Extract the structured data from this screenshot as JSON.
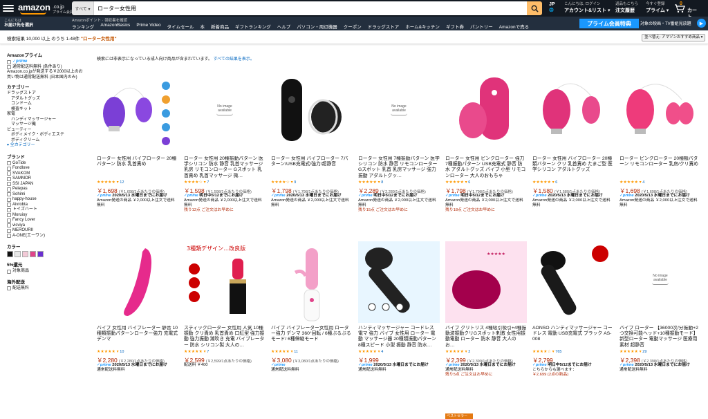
{
  "header": {
    "logo_word": "amazon",
    "logo_tld": ".co.jp",
    "logo_sub": "プライム会員",
    "search_category": "すべて ▾",
    "search_value": "ローター女性用",
    "lang": "JP",
    "lang_sub": "🌐",
    "account_small": "こんにちは, ログイン",
    "account_big": "アカウント&リスト ▾",
    "orders_small": "返品もこちら",
    "orders_big": "注文履歴",
    "prime_small": "今すぐ登録",
    "prime_big": "プライム ▾",
    "cart_count": "0",
    "cart_label": "カート"
  },
  "nav2": {
    "loc_small": "こんにちは",
    "loc_big": "お届け先を選択",
    "mini": "Amazonポイント · 領収書を確認",
    "links": [
      "ランキング",
      "AmazonBasics",
      "Prime Video",
      "タイムセール",
      "本",
      "新着商品",
      "ギフトランキング",
      "ヘルプ",
      "パソコン・周辺機器",
      "クーポン",
      "ドラッグストア",
      "ホーム&キッチン",
      "ギフト券",
      "パントリー",
      "Amazonで売る"
    ],
    "prime_banner": "プライム会員特典",
    "promo": "対象の映画・TV番組見放題",
    "promo_icon": "▶"
  },
  "results": {
    "count_prefix": "検索結果 10,000 以上 のうち 1-48件 ",
    "query": "\"ローター女性用\"",
    "sort": "並べ替え: アマゾンおすすめ商品 ▾",
    "notice": "検索には非表示になっている成人向け商品が含まれています。",
    "notice_link": "すべての結果を表示。"
  },
  "sidebar": {
    "prime_head": "Amazonプライム",
    "prime_logo": "✓prime",
    "free_ship": "通常配送料無料 (条件あり)",
    "free_note": "Amazon.co.jpが発送する￥2000以上のお買い物は通常配送無料 (日本国内のみ)",
    "cat_head": "カテゴリー",
    "cats": [
      "ドラッグストア",
      "アダルトグッズ",
      "コンドーム",
      "検査キット",
      "家電",
      "ハンディマッサージャー",
      "マッサージ機",
      "ビューティー",
      "ボディメイク・ボディエステ",
      "ボディクリーム"
    ],
    "cat_indent": [
      false,
      true,
      true,
      true,
      false,
      true,
      true,
      false,
      true,
      true
    ],
    "cat_more": "▾ 全カテゴリー",
    "brand_head": "ブランド",
    "brands": [
      "GoTide",
      "Fondlove",
      "SVAKOM",
      "SAMMOR",
      "SSI JAPAN",
      "Pelepas",
      "Sohimi",
      "happy-house",
      "Aivrobta",
      "トイズハート",
      "Moruioy",
      "Fancy Lover",
      "vicviya",
      "MEROURII",
      "A-ONE(エーワン)"
    ],
    "color_head": "カラー",
    "colors": [
      "#111111",
      "#e8e8e8",
      "#f2c9d6",
      "#e0448a",
      "#6a2fd0"
    ],
    "disc_head": "5%還元",
    "disc_item": "対象商品",
    "ship_head": "海外配送",
    "ship_item": "配送無料"
  },
  "products": [
    {
      "title": "ローター 女性用 バイブローター 20種バターン 防水 乳首責め",
      "stars": "★★★★★",
      "cnt": "12",
      "price": "￥1,698",
      "unit": "(￥1,698/1点あたりの価格)",
      "prime": true,
      "ship": "2020/5/13 水曜日までにお届け",
      "note": "Amazon発送の商品 ￥2,000以上注文で送料無料",
      "low": "",
      "img": "purple"
    },
    {
      "title": "ローター 女性用 20種振動パターン 医学シリコン 防水 静音 乳首マッサージ 乳房 リモコンローター Gスポット 乳首責め 乳首マッサージ 微…",
      "stars": "★★★★☆",
      "cnt": "7",
      "price": "￥1,598",
      "unit": "(￥1,598/1点あたりの価格)",
      "prime": true,
      "ship": "明日中5/12までにお届け",
      "note": "Amazon発送の商品 ￥2,000以上注文で送料無料",
      "low": "残り12点 ご注文はお早めに",
      "img": "noimage"
    },
    {
      "title": "ローター 女性用 バイブローター 7パターン/USB充電式/強力/超静音",
      "stars": "★★★★☆",
      "cnt": "9",
      "price": "￥1,798",
      "unit": "(￥1,798/1点あたりの価格)",
      "prime": true,
      "ship": "2020/5/13 水曜日までにお届け",
      "note": "Amazon発送の商品 ￥2,000以上注文で送料無料",
      "low": "",
      "img": "black"
    },
    {
      "title": "ローター 女性用 7種振動パターン 医学シリコン 防水 静音 リモコンローター Gスポット 乳首 乳房マッサージ 強力振動 アダルトグッ…",
      "stars": "★★★★★",
      "cnt": "8",
      "price": "￥2,289",
      "unit": "(￥2,289/1点あたりの価格)",
      "prime": true,
      "ship": "明日中5/12までにお届け",
      "note": "Amazon発送の商品 ￥2,000以上注文で送料無料",
      "low": "残り15点 ご注文はお早めに",
      "img": "noimage"
    },
    {
      "title": "ローター 女性用 ピンクローター 強力 7種振動パターン USB充電式 静音 防水 アダルトグッズ バイブ 小型 リモコンローター 大人のおもちゃ",
      "stars": "★★★★★",
      "cnt": "6",
      "price": "￥1,798",
      "unit": "(￥1,798/1点あたりの価格)",
      "prime": true,
      "ship": "明日中5/12までにお届け",
      "note": "Amazon発送の商品 ￥2,000以上注文で送料無料",
      "low": "残り18点 ご注文はお早めに",
      "img": "pink1"
    },
    {
      "title": "ローター 女性用 バイブローター 20種類バターン クリ 乳首責め たまご型 医学シリコン アダルトグッズ",
      "stars": "★★★★★",
      "cnt": "6",
      "price": "￥1,580",
      "unit": "(￥1,580/1点あたりの価格)",
      "prime": true,
      "ship": "2020/5/13 水曜日までにお届け",
      "note": "Amazon発送の商品 ￥2,000以上注文で送料無料",
      "low": "",
      "img": "pink2"
    },
    {
      "title": "ローター ピンクローター 20種類パターン リモコンローター 乳房/クリ責め",
      "stars": "★★★★★",
      "cnt": "4",
      "price": "￥1,698",
      "unit": "(￥1,698/1点あたりの価格)",
      "prime": true,
      "ship": "2020/5/13 水曜日までにお届け",
      "note": "Amazon発送の商品 ￥2,000以上注文で送料無料",
      "low": "",
      "img": "pink3"
    },
    {
      "title": "バイブ 女性用 バイブレーター 静音 10種類振動パターンローター強力 充電式 デンマ",
      "stars": "★★★★★",
      "cnt": "10",
      "price": "￥2,280",
      "unit": "(￥2,280/1点あたりの価格)",
      "prime": true,
      "ship": "2020/5/13 水曜日までにお届け",
      "note": "通常配送料無料",
      "low": "",
      "img": "wand_pink"
    },
    {
      "title": "スティックローター 女性用 人気 10種振動 クリ責め 乳首責め 口紅型 強力振動 強力振動 潮吹き 充電 バイブレーター 防水 シリコン製 大人の…",
      "stars": "★★★★★",
      "cnt": "7",
      "price": "￥2,599",
      "unit": "(￥2,599/1点あたりの価格)",
      "prime": false,
      "ship": "",
      "note": "配送料 ￥400",
      "low": "",
      "img": "lipstick"
    },
    {
      "title": "バイブ バイブレーター女性用 ローター強力 デンマ 360°回転 / 6種ぶるぶるモード/ 6種伸縮モード",
      "stars": "★★★★★",
      "cnt": "11",
      "price": "￥3,080",
      "unit": "(￥3,080/1点あたりの価格)",
      "prime": true,
      "ship": "",
      "note": "通常配送料無料",
      "low": "",
      "img": "rabbit"
    },
    {
      "title": "ハンディマッサージャー コードレス 電マ 強力 バイブ 女性用 ローター 電動 マッサージ器 20種類振動パターン 8種スピード 小型 振動 静音 防水…",
      "stars": "★★★★★",
      "cnt": "4",
      "price": "￥1,999",
      "unit": "",
      "prime": true,
      "ship": "2020/5/13 水曜日までにお届け",
      "note": "通常配送料無料",
      "low": "",
      "img": "handy"
    },
    {
      "title": "バイブ クリトリス 4種吸引吸引+4種振動波振動クリGスポット刺激 女性用振動電動 ローター 防水 静音 大人の お…",
      "stars": "★★★★★",
      "cnt": "2",
      "price": "￥2,399",
      "unit": "(￥2,399/1点あたりの価格)",
      "prime": true,
      "ship": "2020/5/13 水曜日までにお届け",
      "note": "通常配送料無料",
      "low": "残り5点 ご注文はお早めに",
      "img": "suction"
    },
    {
      "title": "AONSO ハンディマッサージャー コードレス 電動 USB充電式 ブラック AS-008",
      "stars": "★★★★☆",
      "cnt": "765",
      "price": "￥2,799",
      "unit": "",
      "prime": true,
      "ship": "明日中5/12までにお届け",
      "note": "こちらからも選べます：",
      "low": "￥2,699 (2点の新品)",
      "img": "massager"
    },
    {
      "title": "バイブ ローター 【36000次/分振動+2つ交換可能ヘッド+10種振動モード】 新型ローター 電動マッサージ 医療用素材 超静音",
      "stars": "★★★★★",
      "cnt": "29",
      "price": "￥2,398",
      "unit": "(￥2,398/1点あたりの価格)",
      "prime": true,
      "ship": "2020/5/13 水曜日までにお届け",
      "note": "通常配送料無料",
      "low": "",
      "img": "noimage"
    }
  ],
  "best_seller": "ベストセラー"
}
